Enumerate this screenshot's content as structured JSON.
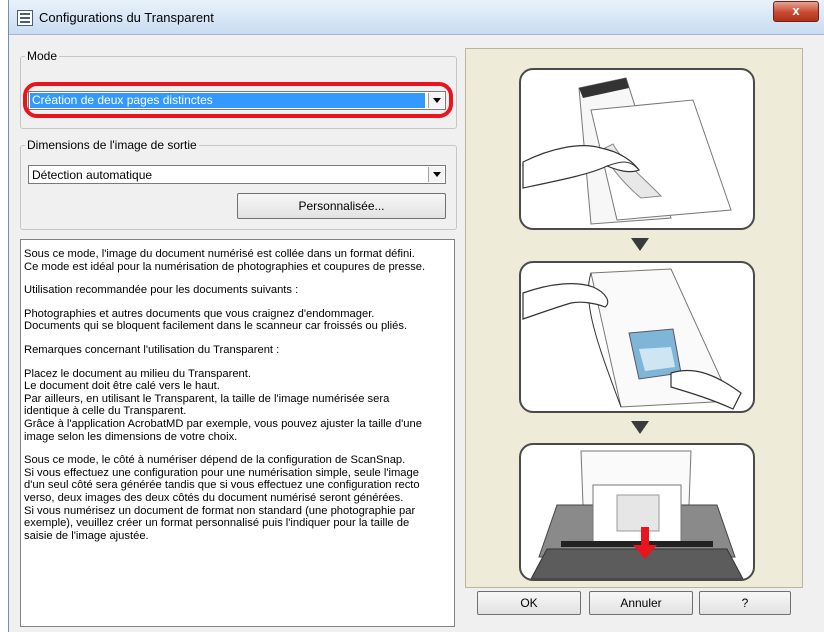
{
  "window": {
    "title": "Configurations du Transparent",
    "close_label": "x"
  },
  "mode": {
    "legend": "Mode",
    "selected": "Création de deux pages distinctes"
  },
  "output": {
    "legend": "Dimensions de l'image de sortie",
    "selected": "Détection automatique",
    "custom_button": "Personnalisée..."
  },
  "description": {
    "paragraphs": [
      "Sous ce mode, l'image du document numérisé est collée dans un format défini.\nCe mode est idéal pour la numérisation de photographies et coupures de presse.",
      "Utilisation recommandée pour les documents suivants :",
      "Photographies et autres documents que vous craignez d'endommager.\nDocuments qui se bloquent facilement dans le scanneur car froissés ou pliés.",
      "Remarques concernant l'utilisation du Transparent :",
      "Placez le document au milieu du Transparent.\nLe document doit être calé vers le haut.\nPar ailleurs, en utilisant le Transparent, la taille de l'image numérisée sera\nidentique à celle du Transparent.\nGrâce à l'application AcrobatMD par exemple, vous pouvez ajuster la taille d'une\nimage selon les dimensions de votre choix.",
      "Sous ce mode, le côté à numériser dépend de la configuration de ScanSnap.\nSi vous effectuez une configuration pour une numérisation simple, seule l'image\nd'un seul côté sera générée tandis que si vous effectuez une configuration recto\nverso, deux images des deux côtés du document numérisé seront générées.\nSi vous numérisez un document de format non standard (une photographie par\nexemple), veuillez créer un format personnalisé puis l'indiquer pour la taille de\nsaisie de l'image ajustée."
    ]
  },
  "buttons": {
    "ok": "OK",
    "cancel": "Annuler",
    "help": "?"
  },
  "colors": {
    "highlight": "#e8141e",
    "selection": "#3399ff"
  }
}
